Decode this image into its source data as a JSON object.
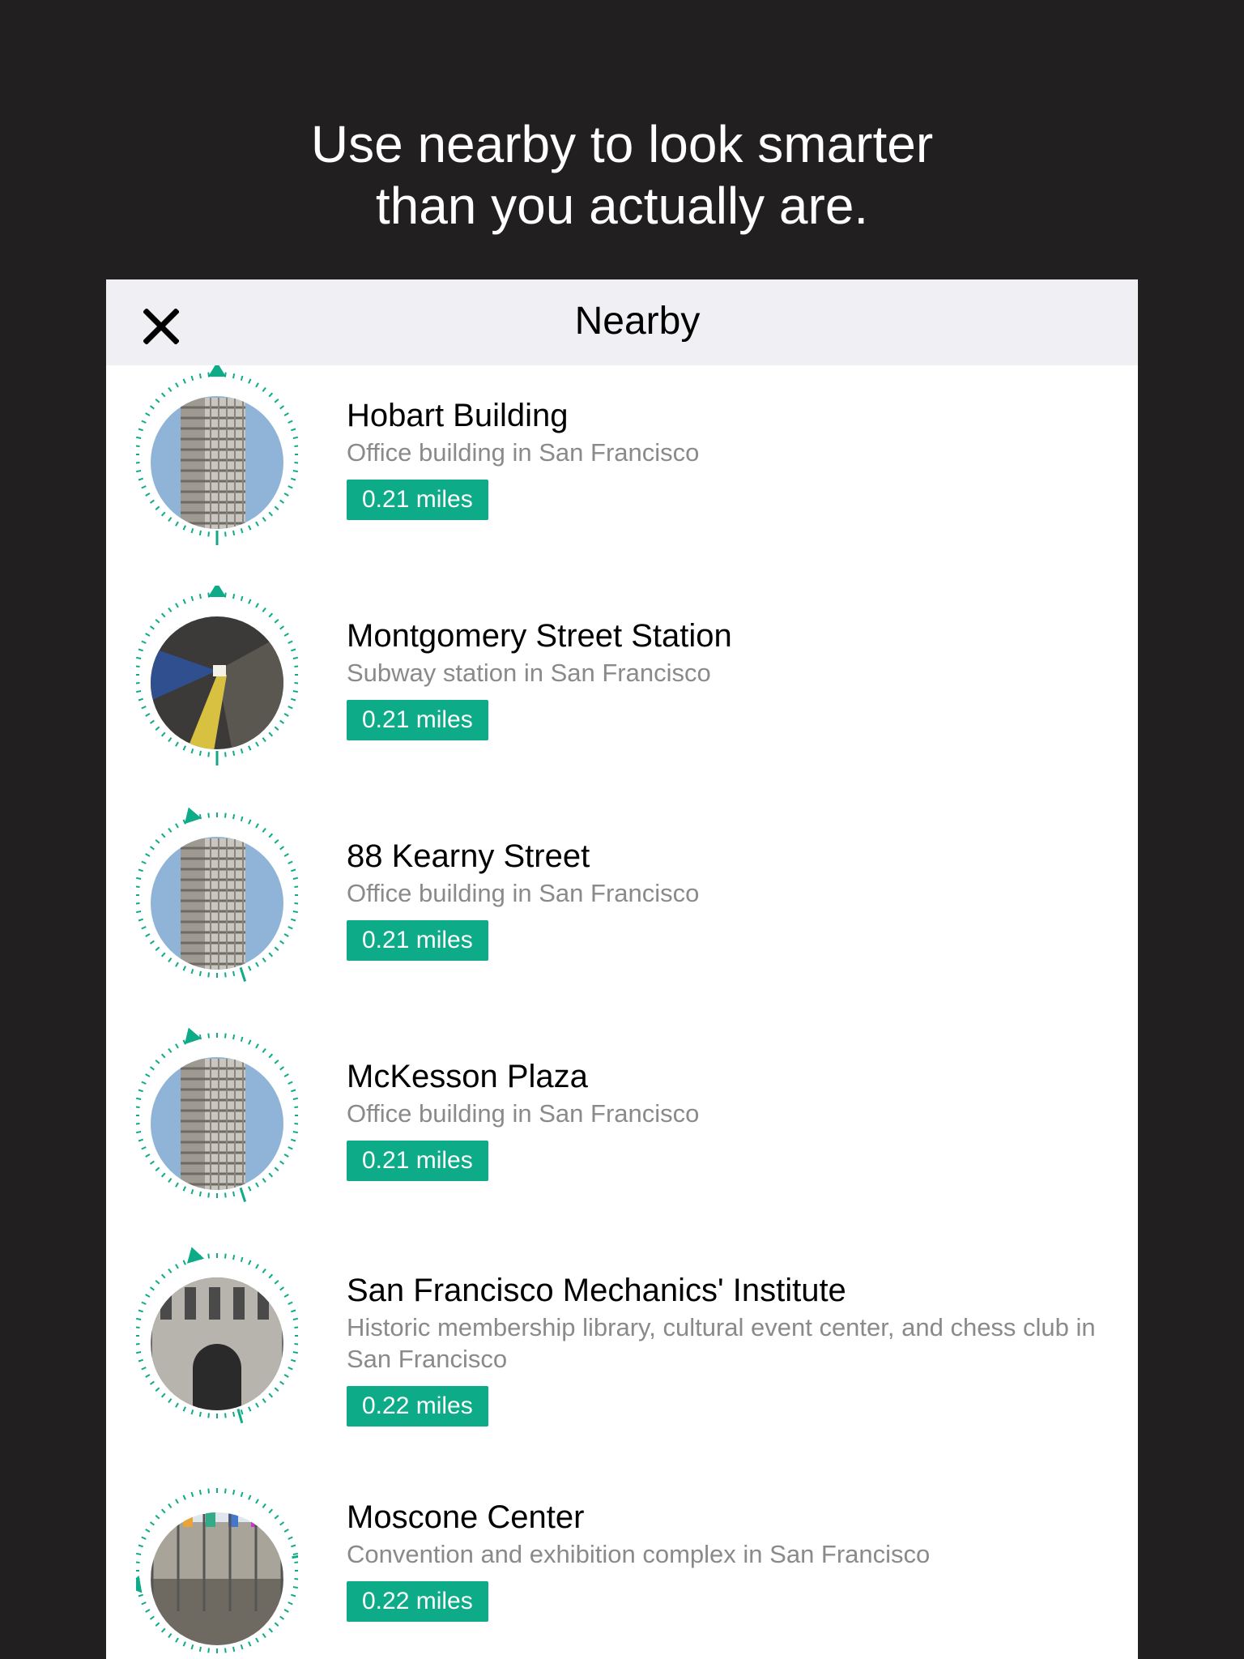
{
  "headline": {
    "line1": "Use nearby to look smarter",
    "line2": "than you actually are."
  },
  "navbar": {
    "title": "Nearby",
    "close_icon": "close-icon"
  },
  "colors": {
    "background": "#221f20",
    "navbar": "#efeff4",
    "accent": "#0dab87",
    "secondary_text": "#8a8a8a"
  },
  "places": [
    {
      "name": "Hobart Building",
      "description": "Office building in San Francisco",
      "distance": "0.21 miles",
      "photo": "office-tower-photo"
    },
    {
      "name": "Montgomery Street Station",
      "description": "Subway station in San Francisco",
      "distance": "0.21 miles",
      "photo": "subway-platform-photo"
    },
    {
      "name": "88 Kearny Street",
      "description": "Office building in San Francisco",
      "distance": "0.21 miles",
      "photo": "office-tower-photo"
    },
    {
      "name": "McKesson Plaza",
      "description": "Office building in San Francisco",
      "distance": "0.21 miles",
      "photo": "office-tower-photo"
    },
    {
      "name": "San Francisco Mechanics' Institute",
      "description": "Historic membership library, cultural event center, and chess club in San Francisco",
      "distance": "0.22 miles",
      "photo": "historic-building-photo"
    },
    {
      "name": "Moscone Center",
      "description": "Convention and exhibition complex in San Francisco",
      "distance": "0.22 miles",
      "photo": "street-plaza-photo"
    }
  ]
}
